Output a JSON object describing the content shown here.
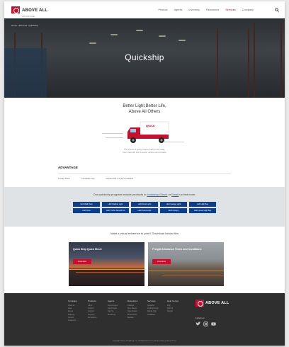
{
  "brand": {
    "name": "ABOVE ALL",
    "tagline": "ADVANTAGE",
    "primary_color": "#c8102e",
    "accent_blue": "#0d3e8c"
  },
  "nav": {
    "items": [
      "Product",
      "Agents",
      "Inventory",
      "Resources",
      "Services",
      "Company"
    ],
    "active": "Services"
  },
  "hero": {
    "breadcrumb": "Home / Services / Quickship",
    "title": "Quickship"
  },
  "intro": {
    "tagline_line1": "Better Light,Better Life,",
    "tagline_line2": "Above All Others",
    "truck_label": "QUICK",
    "desc_line1": "The process of getting fixtures ready to ship today,",
    "desc_line2": "here's how with how to source, achieve and complete"
  },
  "advantage": {
    "title": "ADVANTAGE",
    "items": [
      "Locally Stock",
      "Immediate ship",
      "Guaranteed 2-3 day's available"
    ]
  },
  "products": {
    "intro_prefix": "Our quickship program include products in",
    "intro_link1": "Inventory Check",
    "intro_mid": "or",
    "intro_link2": "Email",
    "intro_suffix": "us find more.",
    "buttons": [
      "LED Wall Pack",
      "LED Parking Light",
      "LED Flood Light",
      "LED Garage Light",
      "LED High Bay",
      "LED Area",
      "LED Troffer Retrofit Kit",
      "LED Panel Light",
      "LED Canopy",
      "LED Linear High Bay"
    ]
  },
  "downloads": {
    "prompt": "Want a visual reference to print? Download below files",
    "cards": [
      {
        "title": "Quick Ship Quick Sheet",
        "button": "Download"
      },
      {
        "title": "Freight Allowance Terms and Conditions",
        "button": "Download"
      }
    ]
  },
  "footer": {
    "columns": [
      {
        "head": "Company",
        "links": [
          "About Us",
          "News",
          "Events",
          "Warranty",
          "Careers",
          "Contact Us"
        ]
      },
      {
        "head": "Products",
        "links": [
          "Indoor",
          "Outdoor",
          "Controls",
          "Inventory",
          "Accessories"
        ]
      },
      {
        "head": "Agents",
        "links": [
          "Find an Agent",
          "Agent Portal",
          "Sign Up",
          "Resources"
        ]
      },
      {
        "head": "Resources",
        "links": [
          "Catalogs",
          "Spec Sheets",
          "Case Studies",
          "Photometrics",
          "Rebates"
        ]
      },
      {
        "head": "Services",
        "links": [
          "Quickship",
          "Lighting Design",
          "Rebate Help",
          "Installation"
        ]
      },
      {
        "head": "Help Center",
        "links": [
          "FAQ",
          "Returns",
          "Support"
        ]
      }
    ],
    "brand_name": "ABOVE ALL",
    "follow_label": "Follow us",
    "social": [
      "twitter-icon",
      "instagram-icon",
      "youtube-icon"
    ],
    "copyright": "Copyright Above All Lighting, Inc. All Rights Reserved | Privacy Policy | Terms of Use"
  }
}
